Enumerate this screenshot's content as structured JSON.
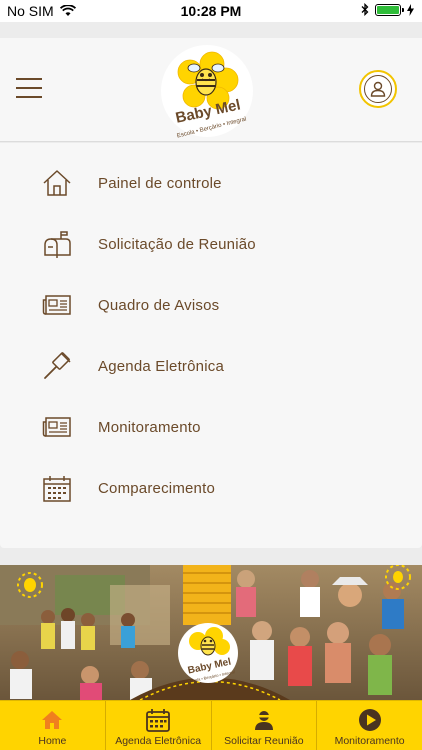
{
  "status_bar": {
    "carrier": "No SIM",
    "time": "10:28 PM"
  },
  "header": {
    "logo_name": "Baby Mel",
    "logo_tagline": "Escola • Berçário • Integral"
  },
  "menu": {
    "items": [
      {
        "label": "Painel de controle",
        "icon": "home-icon"
      },
      {
        "label": "Solicitação de Reunião",
        "icon": "mailbox-icon"
      },
      {
        "label": "Quadro de Avisos",
        "icon": "newspaper-icon"
      },
      {
        "label": "Agenda Eletrônica",
        "icon": "gavel-icon"
      },
      {
        "label": "Monitoramento",
        "icon": "newspaper-icon"
      },
      {
        "label": "Comparecimento",
        "icon": "calendar-icon"
      }
    ]
  },
  "banner": {
    "logo_name": "Baby Mel",
    "logo_tagline": "Escola • Berçário • Integral"
  },
  "tabbar": {
    "tabs": [
      {
        "label": "Home",
        "icon": "home-icon",
        "active": true
      },
      {
        "label": "Agenda Eletrônica",
        "icon": "calendar-icon",
        "active": false
      },
      {
        "label": "Solicitar Reunião",
        "icon": "person-icon",
        "active": false
      },
      {
        "label": "Monitoramento",
        "icon": "play-icon",
        "active": false
      }
    ]
  },
  "colors": {
    "brand_brown": "#6b4a2a",
    "brand_yellow": "#ffd400",
    "active_tab": "#f07f1e",
    "background": "#f7f7f7"
  }
}
